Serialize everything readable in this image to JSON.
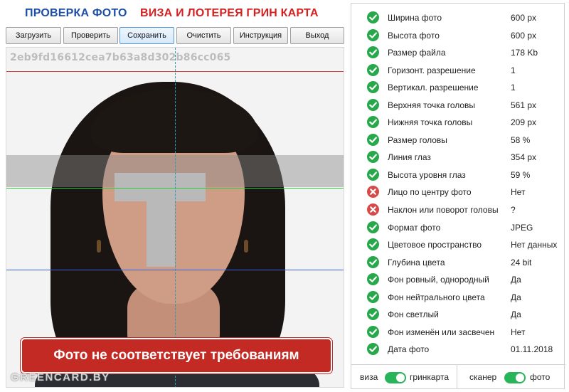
{
  "title": {
    "left": "ПРОВЕРКА ФОТО",
    "right": "ВИЗА И ЛОТЕРЕЯ ГРИН КАРТА",
    "left_color": "#1e4fa8",
    "right_color": "#d42222"
  },
  "toolbar": {
    "load": "Загрузить",
    "check": "Проверить",
    "save": "Сохранить",
    "clear": "Очистить",
    "instruction": "Инструкция",
    "exit": "Выход",
    "active": "save"
  },
  "photo": {
    "hash": "2eb9fd16612cea7b63a8d302b86cc065",
    "banner": "Фото не соответствует требованиям",
    "watermark": "GREENCARD.BY",
    "guide_colors": {
      "top": "#e04040",
      "eyes": "#2ecc40",
      "bottom": "#3a62d8",
      "center": "#2a9bb8"
    }
  },
  "checks": [
    {
      "label": "Ширина фото",
      "value": "600 px",
      "status": "ok"
    },
    {
      "label": "Высота фото",
      "value": "600 px",
      "status": "ok"
    },
    {
      "label": "Размер файла",
      "value": "178 Kb",
      "status": "ok"
    },
    {
      "label": "Горизонт. разрешение",
      "value": "1",
      "status": "ok"
    },
    {
      "label": "Вертикал. разрешение",
      "value": "1",
      "status": "ok"
    },
    {
      "label": "Верхняя точка головы",
      "value": "561 px",
      "status": "ok"
    },
    {
      "label": "Нижняя точка головы",
      "value": "209 px",
      "status": "ok"
    },
    {
      "label": "Размер головы",
      "value": "58 %",
      "status": "ok"
    },
    {
      "label": "Линия глаз",
      "value": "354 px",
      "status": "ok"
    },
    {
      "label": "Высота уровня глаз",
      "value": "59 %",
      "status": "ok"
    },
    {
      "label": "Лицо по центру фото",
      "value": "Нет",
      "status": "bad"
    },
    {
      "label": "Наклон или поворот головы",
      "value": "?",
      "status": "bad"
    },
    {
      "label": "Формат фото",
      "value": "JPEG",
      "status": "ok"
    },
    {
      "label": "Цветовое пространство",
      "value": "Нет данных",
      "status": "ok"
    },
    {
      "label": "Глубина цвета",
      "value": "24 bit",
      "status": "ok"
    },
    {
      "label": "Фон ровный, однородный",
      "value": "Да",
      "status": "ok"
    },
    {
      "label": "Фон нейтрального цвета",
      "value": "Да",
      "status": "ok"
    },
    {
      "label": "Фон светлый",
      "value": "Да",
      "status": "ok"
    },
    {
      "label": "Фон изменён или засвечен",
      "value": "Нет",
      "status": "ok"
    },
    {
      "label": "Дата фото",
      "value": "01.11.2018",
      "status": "ok"
    }
  ],
  "toggles": {
    "mode_left": "виза",
    "mode_right": "гринкарта",
    "mode_on": true,
    "source_left": "сканер",
    "source_right": "фото",
    "source_on": true
  },
  "colors": {
    "ok": "#27a84a",
    "bad": "#d84a4a",
    "toggle_on": "#27b45a",
    "banner": "#c32a24"
  }
}
